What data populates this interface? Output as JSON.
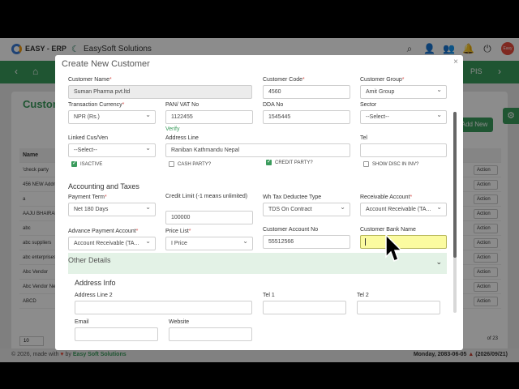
{
  "app": {
    "brand": "EASY - ERP",
    "company": "EasySoft Solutions",
    "avatar_text": "Easy Soft"
  },
  "menu": {
    "pis": "PIS"
  },
  "background": {
    "page_title": "Custom",
    "add_new": "Add New",
    "table_header": "Name",
    "rows": [
      "'check party",
      "456 NEW Addre",
      "a",
      "AAJU BHAIRAB",
      "abc",
      "abc suppliers",
      "abc enterprises",
      "Abc Vendor",
      "Abc Vendor New",
      "ABCD"
    ],
    "action_label": "Action",
    "page_size": "10",
    "pager_text": "of 23"
  },
  "footer": {
    "left_prefix": "© 2026, made with",
    "left_by": "by",
    "left_company": "Easy Soft Solutions",
    "right": "Monday, 2083-06-05",
    "right_ad": "(2026/09/21)"
  },
  "modal": {
    "title": "Create New Customer",
    "close": "×",
    "fields": {
      "customer_name": {
        "label": "Customer Name",
        "value": "Suman Pharma pvt.ltd"
      },
      "customer_code": {
        "label": "Customer Code",
        "value": "4560"
      },
      "customer_group": {
        "label": "Customer Group",
        "value": "Amit Group"
      },
      "transaction_currency": {
        "label": "Transaction Currency",
        "value": "NPR (Rs.)"
      },
      "pan_vat": {
        "label": "PAN/ VAT No",
        "value": "1122455"
      },
      "verify": "Verify",
      "dda_no": {
        "label": "DDA No",
        "value": "1545445"
      },
      "sector": {
        "label": "Sector",
        "value": "--Select--"
      },
      "linked": {
        "label": "Linked Cus/Ven",
        "value": "--Select--"
      },
      "address": {
        "label": "Address Line",
        "value": "Raniban Kathmandu Nepal"
      },
      "tel": {
        "label": "Tel",
        "value": ""
      },
      "isactive": "ISACTIVE",
      "cash_party": "CASH PARTY?",
      "credit_party": "CREDIT PARTY?",
      "show_disc": "SHOW DISC IN INV?",
      "section_accounting": "Accounting and Taxes",
      "payment_term": {
        "label": "Payment Term",
        "value": "Net 180 Days"
      },
      "credit_limit": {
        "label": "Credit Limit (-1 means unlimited)",
        "value": "100000"
      },
      "wh_tax": {
        "label": "Wh Tax Deductee Type",
        "value": "TDS On Contract"
      },
      "receivable": {
        "label": "Receivable Account",
        "value": "Account Receivable (TA..."
      },
      "advance_payment": {
        "label": "Advance Payment Account",
        "value": "Account Receivable (TA..."
      },
      "price_list": {
        "label": "Price List",
        "value": "I Price"
      },
      "customer_account": {
        "label": "Customer Account No",
        "value": "55512566"
      },
      "customer_bank": {
        "label": "Customer Bank Name",
        "value": ""
      },
      "section_other": "Other Details",
      "section_address": "Address Info",
      "address_line2": {
        "label": "Address Line 2",
        "value": ""
      },
      "tel1": {
        "label": "Tel 1",
        "value": ""
      },
      "tel2": {
        "label": "Tel 2",
        "value": ""
      },
      "email": {
        "label": "Email",
        "value": ""
      },
      "website": {
        "label": "Website",
        "value": ""
      }
    }
  }
}
